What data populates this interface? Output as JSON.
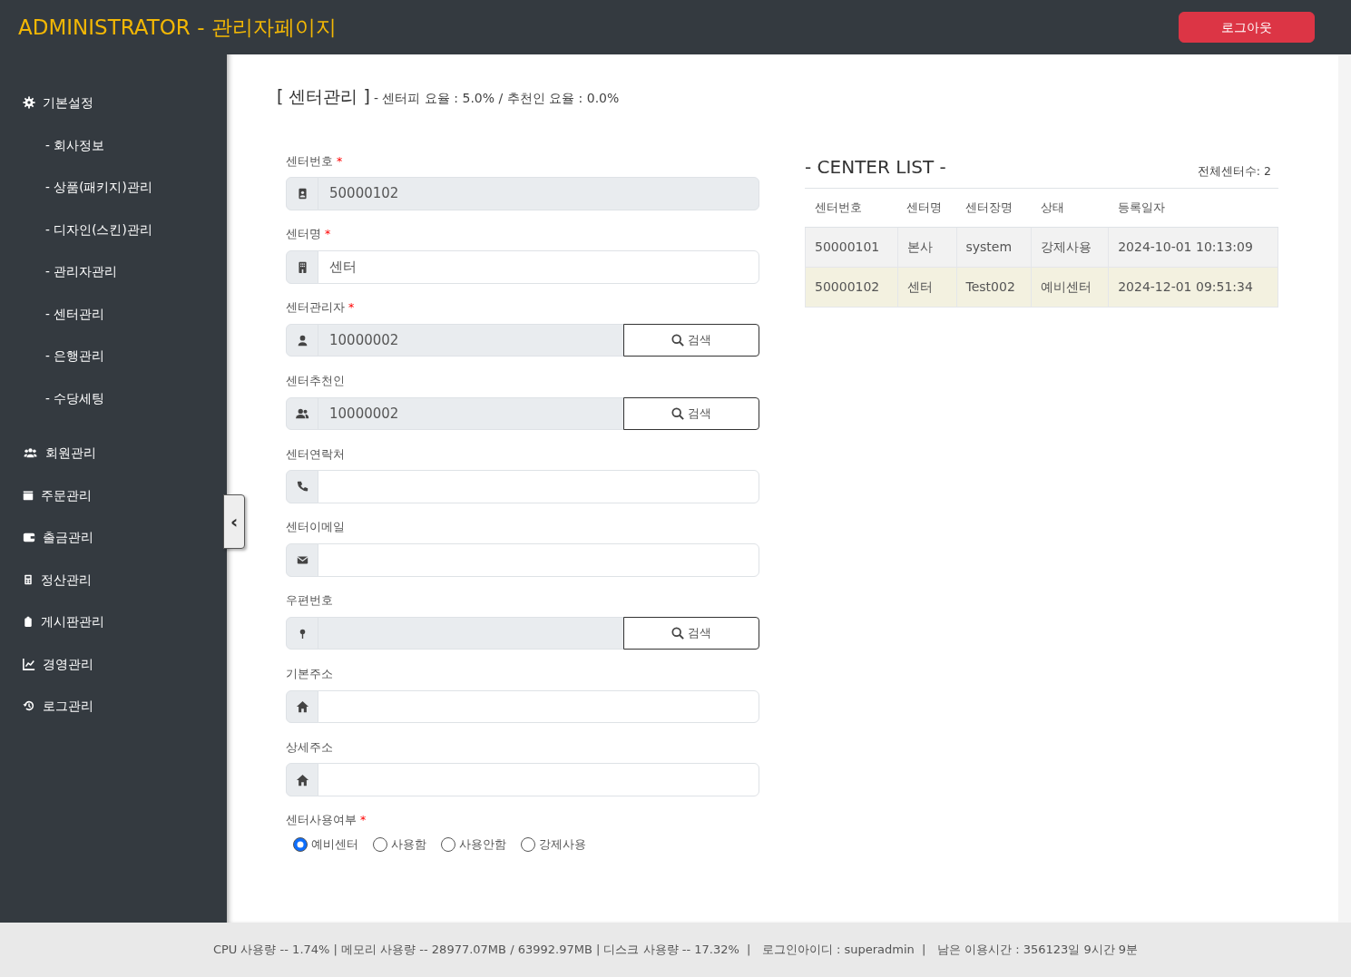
{
  "header": {
    "title": "ADMINISTRATOR - 관리자페이지",
    "logout": "로그아웃"
  },
  "sidebar": {
    "toggle": "‹",
    "items": [
      {
        "label": "기본설정",
        "children": [
          {
            "label": "- 회사정보"
          },
          {
            "label": "- 상품(패키지)관리"
          },
          {
            "label": "- 디자인(스킨)관리"
          },
          {
            "label": "- 관리자관리"
          },
          {
            "label": "- 센터관리"
          },
          {
            "label": "- 은행관리"
          },
          {
            "label": "- 수당세팅"
          }
        ]
      },
      {
        "label": "회원관리"
      },
      {
        "label": "주문관리"
      },
      {
        "label": "출금관리"
      },
      {
        "label": "정산관리"
      },
      {
        "label": "게시판관리"
      },
      {
        "label": "경영관리"
      },
      {
        "label": "로그관리"
      }
    ]
  },
  "page": {
    "title": "[ 센터관리 ]",
    "subtitle": "- 센터피 요율 : 5.0% / 추천인 요율 : 0.0%"
  },
  "form": {
    "fields": [
      {
        "label": "센터번호",
        "mark": "*",
        "value": "50000102",
        "readonly": true
      },
      {
        "label": "센터명",
        "mark": "*",
        "value": "센터",
        "readonly": false
      },
      {
        "label": "센터관리자",
        "mark": "*",
        "value": "10000002",
        "readonly": true,
        "button": "검색"
      },
      {
        "label": "센터추천인",
        "value": "10000002",
        "readonly": true,
        "button": "검색"
      },
      {
        "label": "센터연락처",
        "readonly": false
      },
      {
        "label": "센터이메일",
        "readonly": false
      },
      {
        "label": "우편번호",
        "readonly": true,
        "button": "검색"
      },
      {
        "label": "기본주소",
        "readonly": false
      },
      {
        "label": "상세주소",
        "readonly": false
      }
    ],
    "usage": {
      "label": "센터사용여부",
      "mark": "*",
      "options": [
        {
          "label": "예비센터",
          "selected": true
        },
        {
          "label": "사용함",
          "selected": false
        },
        {
          "label": "사용안함",
          "selected": false
        },
        {
          "label": "강제사용",
          "selected": false
        }
      ]
    }
  },
  "center_list": {
    "title": "- CENTER LIST -",
    "count": "전체센터수: 2",
    "columns": [
      "센터번호",
      "센터명",
      "센터장명",
      "상태",
      "등록일자"
    ],
    "rows": [
      {
        "cells": [
          "50000101",
          "본사",
          "system",
          "강제사용",
          "2024-10-01 10:13:09"
        ],
        "selected": false
      },
      {
        "cells": [
          "50000102",
          "센터",
          "Test002",
          "예비센터",
          "2024-12-01 09:51:34"
        ],
        "selected": true
      }
    ]
  },
  "status_bar": "CPU 사용량 -- 1.74% | 메모리 사용량 -- 28977.07MB / 63992.97MB | 디스크 사용량 -- 17.32%  |   로그인아이디 : superadmin  |   남은 이용시간 : 356123일 9시간 9분"
}
